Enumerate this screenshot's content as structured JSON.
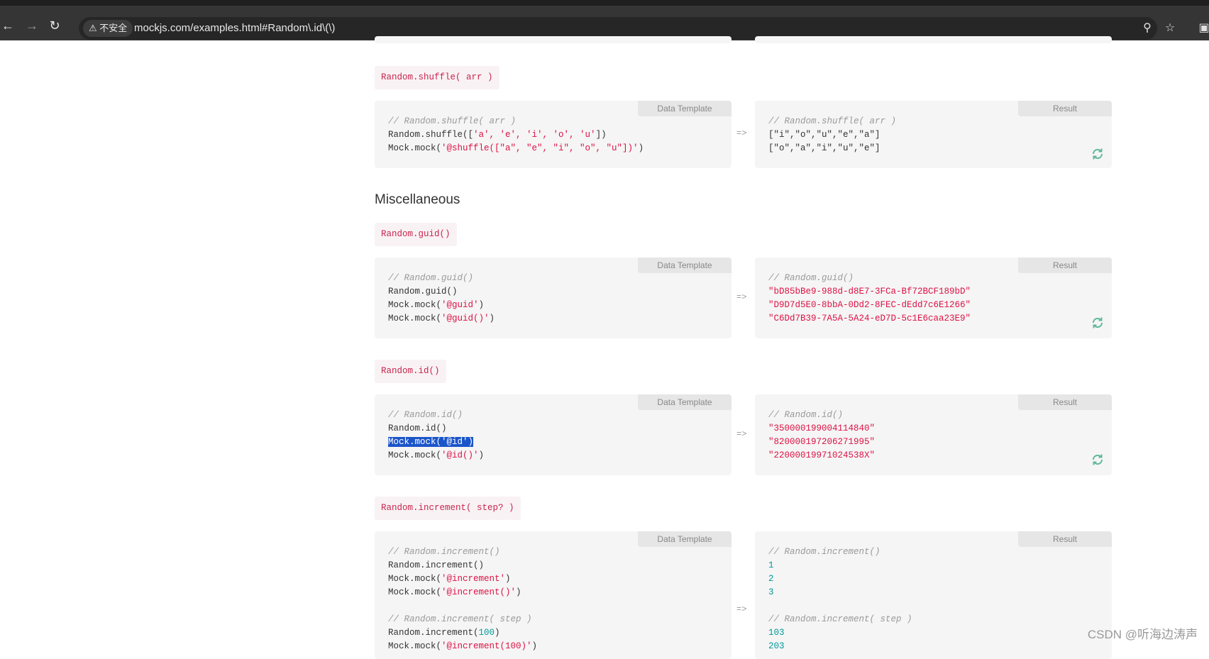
{
  "browser": {
    "security_label": "不安全",
    "url": "mockjs.com/examples.html#Random\\.id\\(\\)"
  },
  "sections": {
    "misc_heading": "Miscellaneous"
  },
  "tabs": {
    "data_template": "Data Template",
    "result": "Result",
    "arrow": "=>"
  },
  "shuffle": {
    "label": "Random.shuffle( arr )",
    "template": {
      "comment": "// Random.shuffle( arr )",
      "line1_pre": "Random.shuffle([",
      "line1_str": "'a', 'e', 'i', 'o', 'u'",
      "line1_post": "])",
      "line2_pre": "Mock.mock(",
      "line2_str": "'@shuffle([\"a\", \"e\", \"i\", \"o\", \"u\"])'",
      "line2_post": ")"
    },
    "result": {
      "comment": "// Random.shuffle( arr )",
      "lines": [
        "[\"i\",\"o\",\"u\",\"e\",\"a\"]",
        "[\"o\",\"a\",\"i\",\"u\",\"e\"]"
      ]
    }
  },
  "guid": {
    "label": "Random.guid()",
    "template": {
      "comment": "// Random.guid()",
      "line1": "Random.guid()",
      "line2_pre": "Mock.mock(",
      "line2_str": "'@guid'",
      "line2_post": ")",
      "line3_pre": "Mock.mock(",
      "line3_str": "'@guid()'",
      "line3_post": ")"
    },
    "result": {
      "comment": "// Random.guid()",
      "lines": [
        "\"bD85bBe9-988d-d8E7-3FCa-Bf72BCF189bD\"",
        "\"D9D7d5E0-8bbA-0Dd2-8FEC-dEdd7c6E1266\"",
        "\"C6Dd7B39-7A5A-5A24-eD7D-5c1E6caa23E9\""
      ]
    }
  },
  "id": {
    "label": "Random.id()",
    "template": {
      "comment": "// Random.id()",
      "line1": "Random.id()",
      "line2_selected": "Mock.mock('@id')",
      "line3_pre": "Mock.mock(",
      "line3_str": "'@id()'",
      "line3_post": ")"
    },
    "result": {
      "comment": "// Random.id()",
      "lines": [
        "\"350000199004114840\"",
        "\"820000197206271995\"",
        "\"22000019971024538X\""
      ]
    }
  },
  "increment": {
    "label": "Random.increment( step? )",
    "template": {
      "comment1": "// Random.increment()",
      "line1": "Random.increment()",
      "line2_pre": "Mock.mock(",
      "line2_str": "'@increment'",
      "line2_post": ")",
      "line3_pre": "Mock.mock(",
      "line3_str": "'@increment()'",
      "line3_post": ")",
      "comment2": "// Random.increment( step )",
      "line4_pre": "Random.increment(",
      "line4_num": "100",
      "line4_post": ")",
      "line5_pre": "Mock.mock(",
      "line5_str": "'@increment(100)'",
      "line5_post": ")"
    },
    "result": {
      "comment1": "// Random.increment()",
      "lines1": [
        "1",
        "2",
        "3"
      ],
      "comment2": "// Random.increment( step )",
      "lines2": [
        "103",
        "203"
      ]
    }
  },
  "watermark": "CSDN @听海边涛声",
  "colors": {
    "label_text": "#c7254e",
    "label_bg": "#f9f2f4",
    "string": "#dd1144",
    "number": "#009999",
    "selection": "#1b55c9",
    "refresh": "#5fb89a"
  }
}
